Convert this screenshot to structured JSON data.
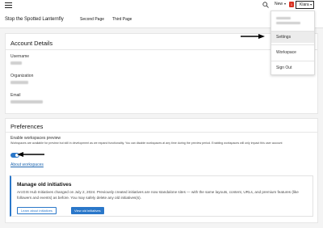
{
  "topbar": {
    "new_label": "New",
    "notification_count": "1",
    "user_label": "Klara"
  },
  "site": {
    "title": "Stop the Spotted Lanternfly",
    "nav": [
      "Second Page",
      "Third Page"
    ]
  },
  "account": {
    "title": "Account Details",
    "username_label": "Username",
    "organization_label": "Organization",
    "email_label": "Email"
  },
  "preferences": {
    "title": "Preferences",
    "enable_label": "Enable workspaces preview",
    "description": "Workspaces are available for preview but still in development as we expand functionality. You can disable workspaces at any time during the preview period. Enabling workspaces will only impact this user account",
    "toggle_on": true,
    "about_link": "About workspaces"
  },
  "notice": {
    "title": "Manage old initiatives",
    "body": "ArcGIS Hub Initiatives changed on July 2, 2024. Previously created initiatives are now standalone sites — with the same layouts, content, URLs, and premium features (like followers and events) as before. You may safely delete any old initiatives(s).",
    "learn_label": "Learn about initiatives",
    "view_label": "View old initiatives"
  },
  "dropdown": {
    "items": [
      "Settings",
      "Workspace",
      "Sign Out"
    ],
    "active": "Settings"
  },
  "colors": {
    "accent": "#2a77c9",
    "notification": "#d83020"
  }
}
